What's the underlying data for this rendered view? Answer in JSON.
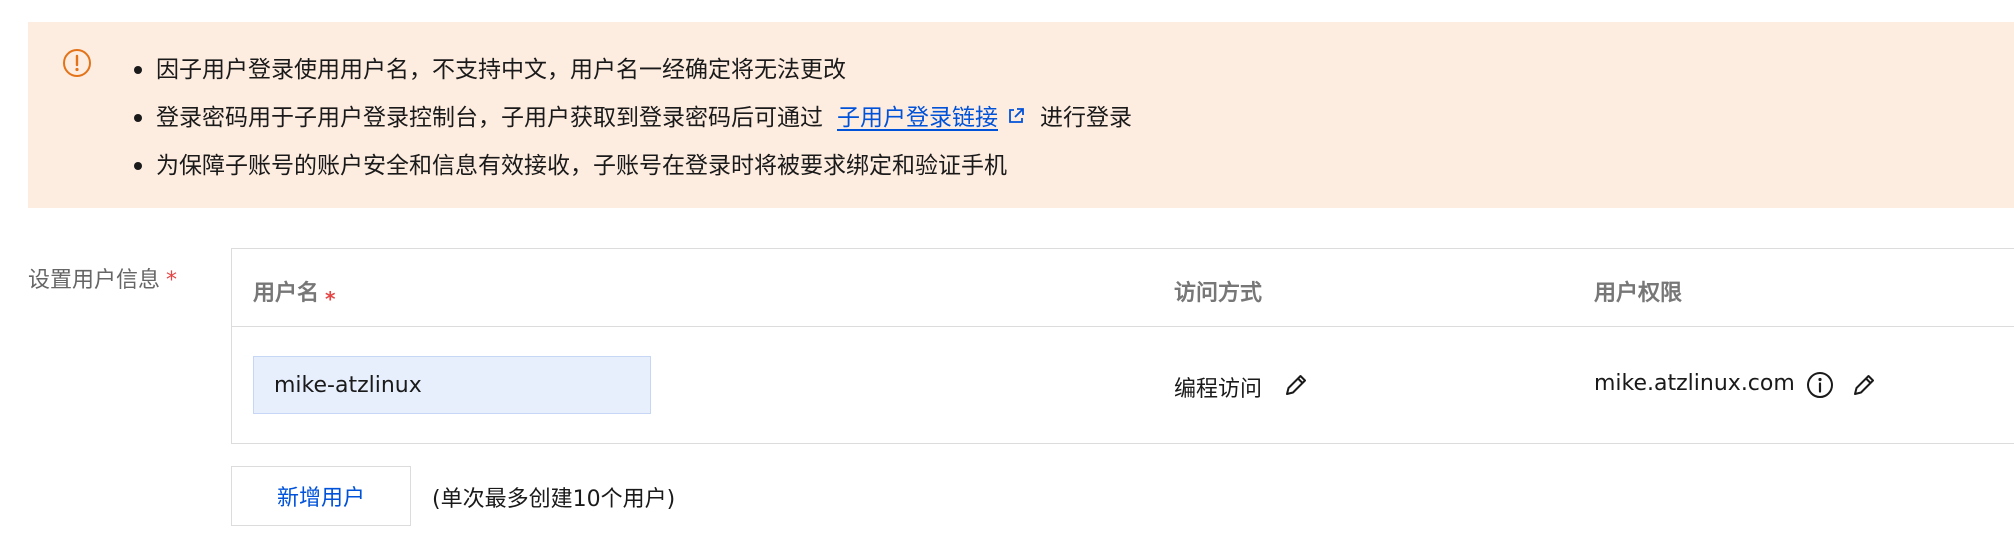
{
  "notice": {
    "icon": "warning-circle-icon",
    "accent_color": "#e37318",
    "background_color": "#fdece0",
    "items": [
      {
        "text": "因子用户登录使用用户名，不支持中文，用户名一经确定将无法更改"
      },
      {
        "text_before": "登录密码用于子用户登录控制台，子用户获取到登录密码后可通过",
        "link": "子用户登录链接",
        "link_icon": "external-link-icon",
        "text_after": "进行登录"
      },
      {
        "text": "为保障子账号的账户安全和信息有效接收，子账号在登录时将被要求绑定和验证手机"
      }
    ]
  },
  "form": {
    "label": "设置用户信息",
    "required_mark": "*",
    "table": {
      "headers": {
        "username": "用户名",
        "access": "访问方式",
        "permission": "用户权限"
      },
      "rows": [
        {
          "username": "mike-atzlinux",
          "access": "编程访问",
          "access_edit_icon": "pencil-icon",
          "permission": "mike.atzlinux.com",
          "permission_info_icon": "info-circle-icon",
          "permission_edit_icon": "pencil-icon"
        }
      ]
    },
    "add_button": "新增用户",
    "add_hint": "(单次最多创建10个用户)"
  },
  "colors": {
    "link": "#0052d9",
    "required": "#e54545",
    "input_bg": "#e7effd"
  }
}
